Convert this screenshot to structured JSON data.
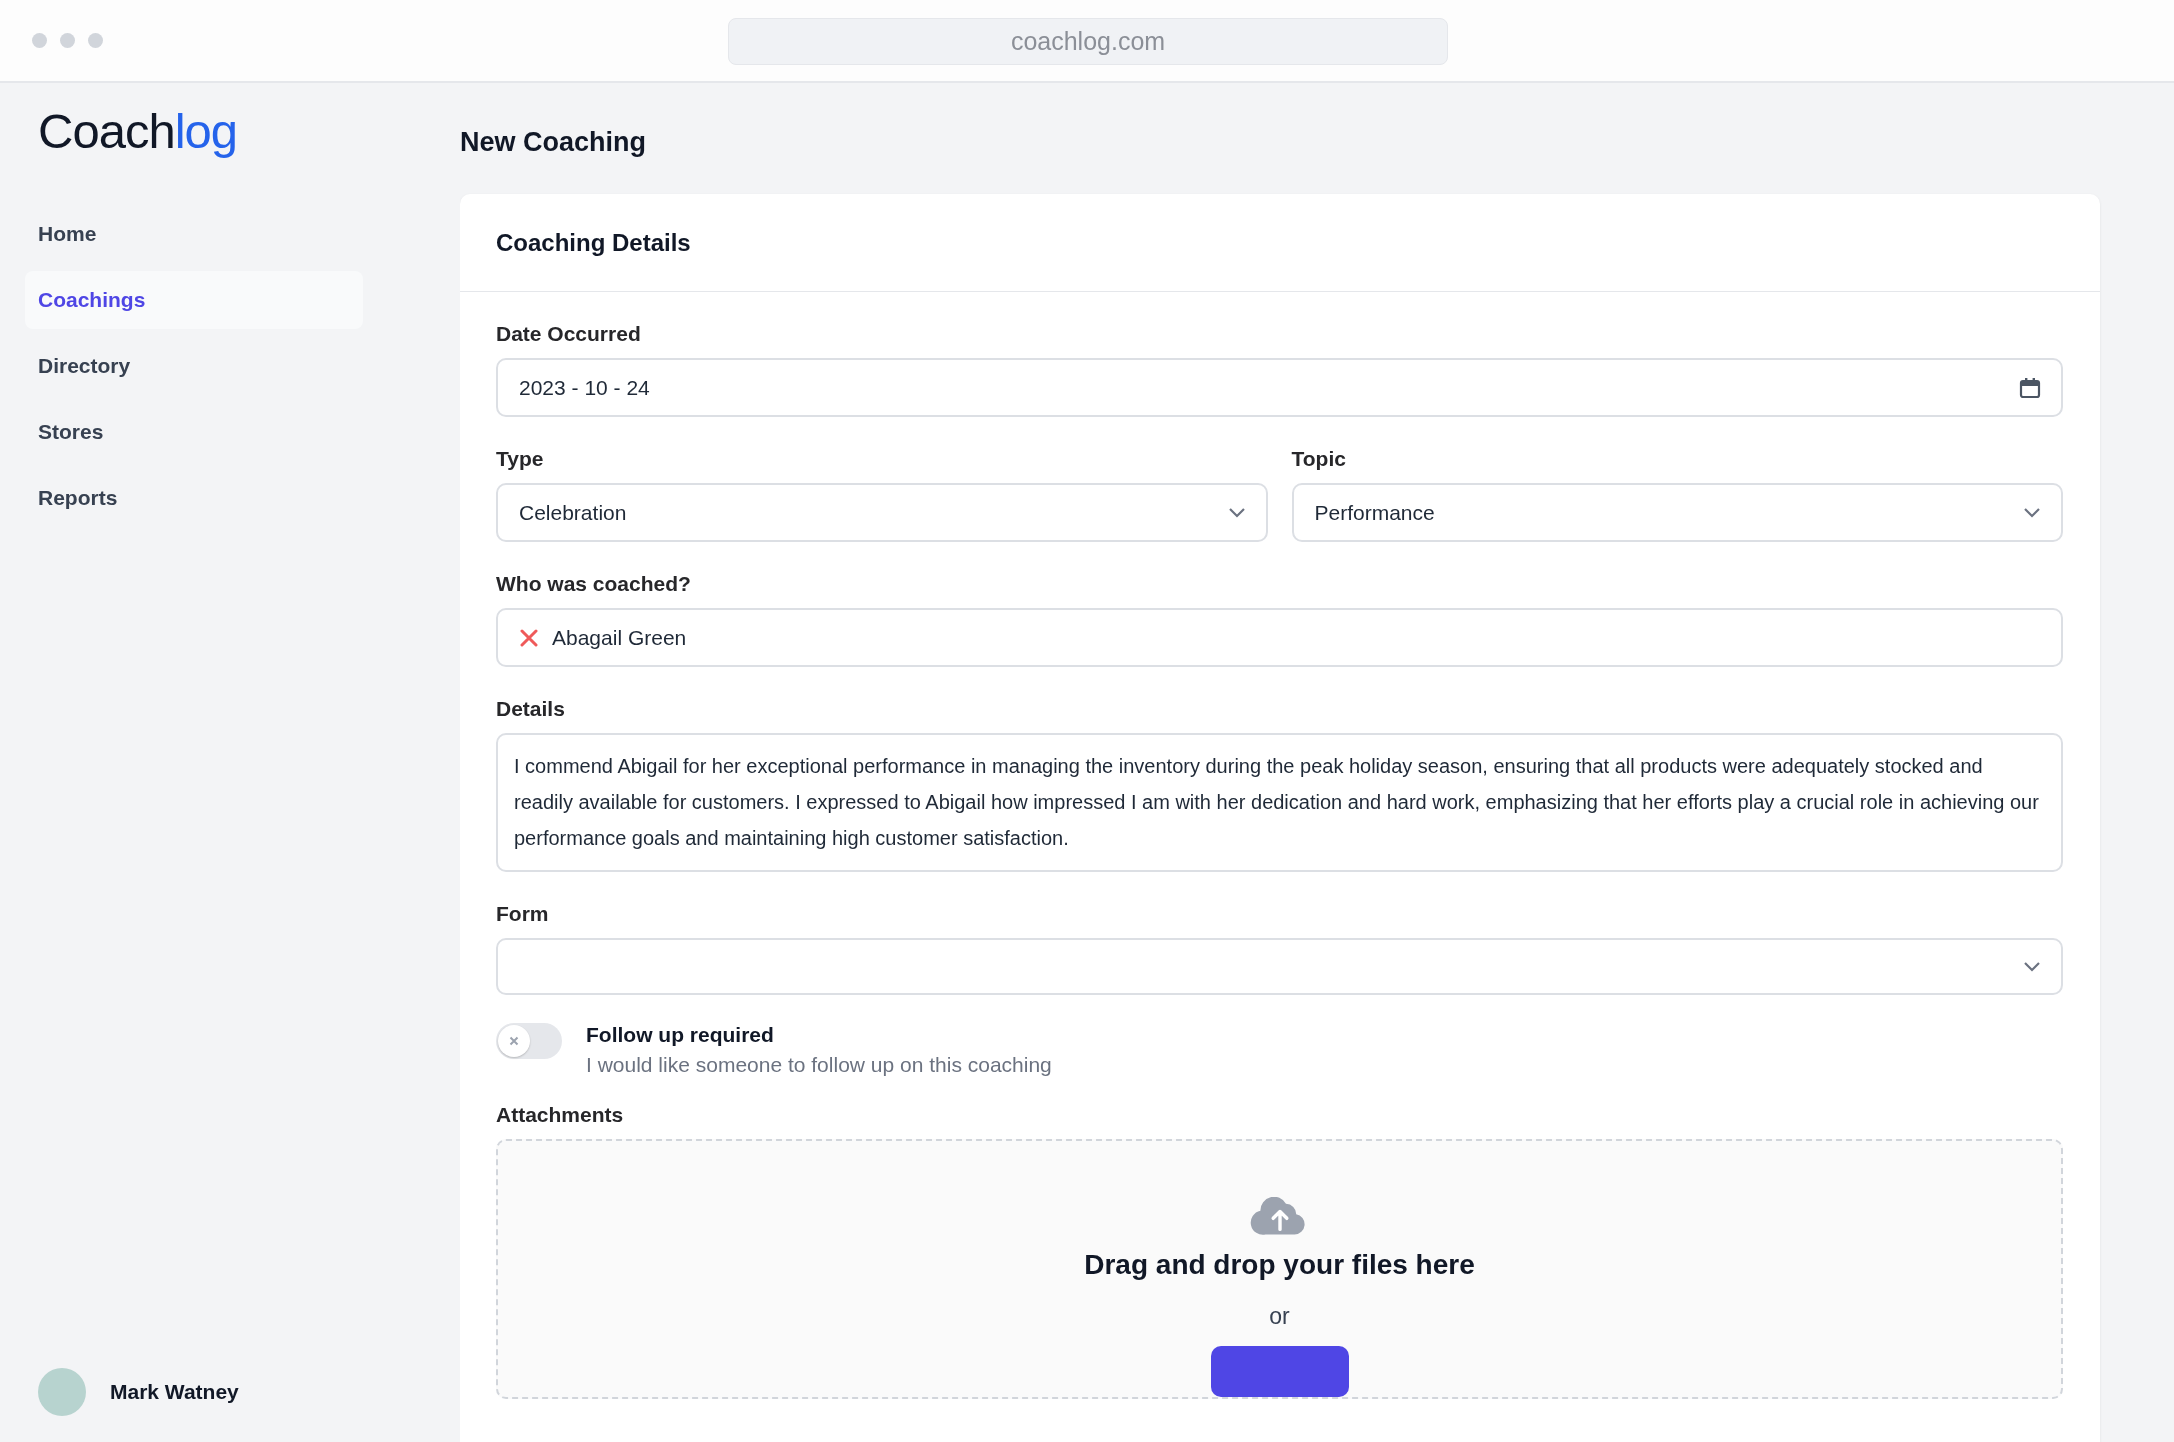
{
  "browser": {
    "url": "coachlog.com"
  },
  "sidebar": {
    "logo": {
      "dark": "Coach",
      "accent": "log"
    },
    "items": [
      {
        "label": "Home",
        "selected": false
      },
      {
        "label": "Coachings",
        "selected": true
      },
      {
        "label": "Directory",
        "selected": false
      },
      {
        "label": "Stores",
        "selected": false
      },
      {
        "label": "Reports",
        "selected": false
      }
    ],
    "user": {
      "name": "Mark Watney"
    }
  },
  "page_title": "New Coaching",
  "card": {
    "title": "Coaching Details",
    "date": {
      "label": "Date Occurred",
      "value": "2023 - 10 - 24"
    },
    "type": {
      "label": "Type",
      "value": "Celebration"
    },
    "topic": {
      "label": "Topic",
      "value": "Performance"
    },
    "coached": {
      "label": "Who was coached?",
      "people": [
        "Abagail Green"
      ]
    },
    "details": {
      "label": "Details",
      "value": "I commend Abigail for her exceptional performance in managing the inventory during the peak holiday season, ensuring that all products were adequately stocked and readily available for customers. I expressed to Abigail how impressed I am with her dedication and hard work, emphasizing that her efforts play a crucial role in achieving our performance goals and maintaining high customer satisfaction."
    },
    "form": {
      "label": "Form"
    },
    "follow_up": {
      "on": false,
      "title": "Follow up required",
      "description": "I would like someone to follow up on this coaching"
    },
    "attachments": {
      "label": "Attachments",
      "prompt": "Drag and drop your files here",
      "separator": "or"
    }
  }
}
